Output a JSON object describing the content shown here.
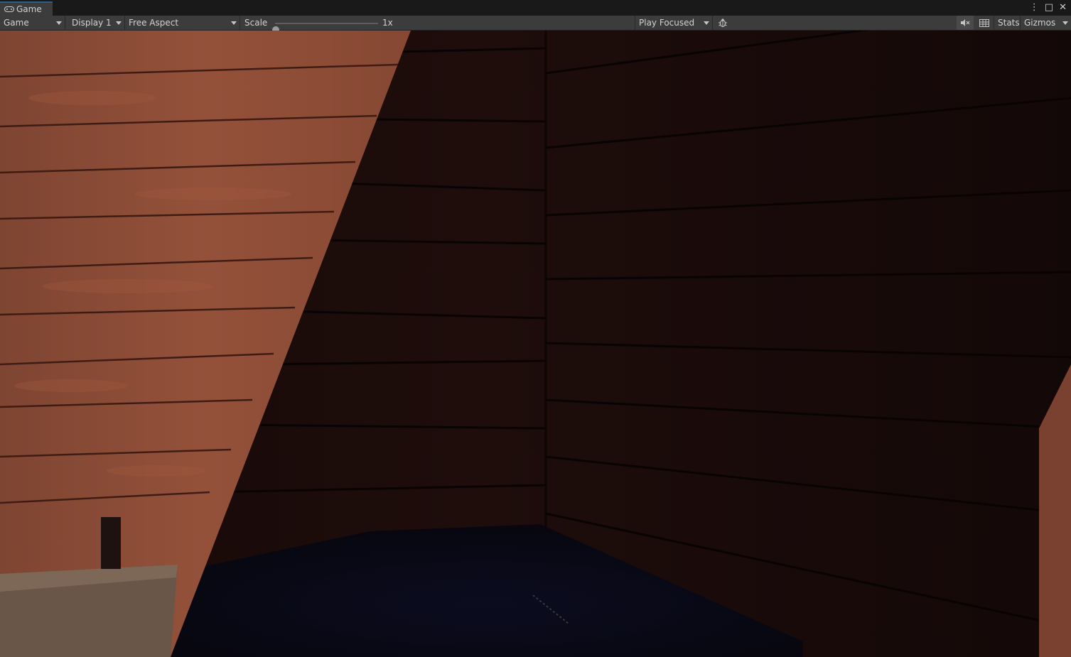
{
  "tab": {
    "title": "Game",
    "icon": "gamepad-icon"
  },
  "window_controls": {
    "menu": "⋮",
    "maximize": "□",
    "close": "✕"
  },
  "toolbar": {
    "view_mode": "Game",
    "display": "Display 1",
    "aspect": "Free Aspect",
    "scale_label": "Scale",
    "scale_value_text": "1x",
    "scale_fraction": 0.0,
    "play_mode": "Play Focused",
    "stats": "Stats",
    "gizmos": "Gizmos"
  },
  "colors": {
    "tab_accent": "#2c5d87",
    "toolbar_bg": "#3c3c3c",
    "wood_light": "#8a4a34",
    "wood_dark": "#1a0c0b",
    "floor_dark": "#0a0a18"
  }
}
